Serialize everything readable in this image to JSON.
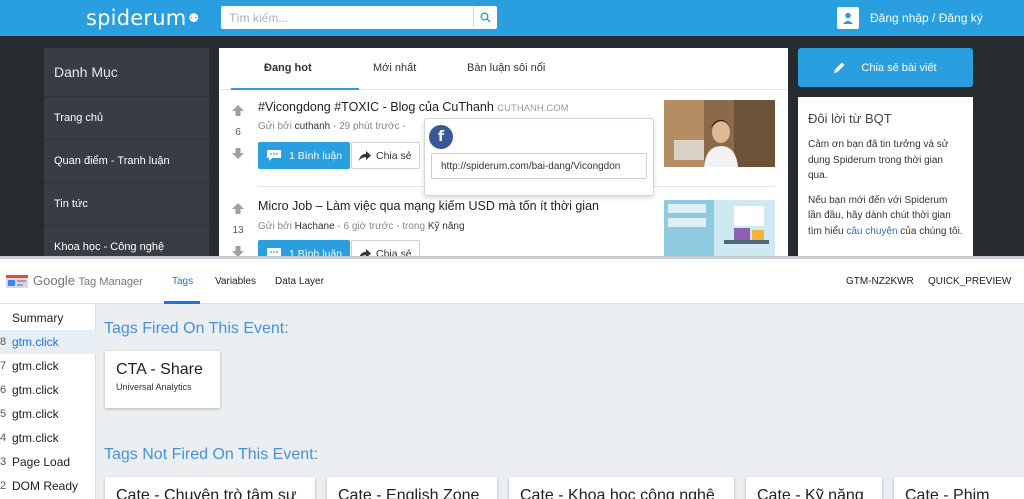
{
  "site": {
    "logo": "spiderum",
    "search_placeholder": "Tìm kiếm...",
    "login_label": "Đăng nhập / Đăng ký",
    "sidebar": {
      "title": "Danh Mục",
      "items": [
        "Trang chủ",
        "Quan điểm - Tranh luận",
        "Tin tức",
        "Khoa học - Công nghệ"
      ]
    },
    "tabs": [
      "Đang hot",
      "Mới nhất",
      "Bàn luận sôi nổi"
    ],
    "posts": [
      {
        "votes": "6",
        "title": "#Vicongdong #TOXIC - Blog của CuThanh",
        "source": "CUTHANH.COM",
        "meta_prefix": "Gửi bởi",
        "author": "cuthanh",
        "meta_time": "- 29 phút trước -",
        "meta_cat": "",
        "comments": "1 Bình luận",
        "share": "Chia sẻ"
      },
      {
        "votes": "13",
        "title": "Micro Job – Làm việc qua mạng kiếm USD mà tốn ít thời gian",
        "source": "",
        "meta_prefix": "Gửi bởi",
        "author": "Hachane",
        "meta_time": "- 6 giờ trước - trong",
        "meta_cat": "Kỹ năng",
        "comments": "1 Bình luận",
        "share": "Chia sẻ"
      }
    ],
    "share_popup_url": "http://spiderum.com/bai-dang/Vicongdon",
    "share_button": "Chia sẻ bài viết",
    "note": {
      "title": "Đôi lời từ BQT",
      "p1": "Cảm ơn bạn đã tin tưởng và sử dụng Spiderum trong thời gian qua.",
      "p2_before": "Nếu bạn mới đến với Spiderum lần đầu, hãy dành chút thời gian tìm hiểu",
      "p2_link": "câu chuyện",
      "p2_after": "của chúng tôi."
    },
    "colors": {
      "brand": "#2a9fe0",
      "dark_bg": "#262b30"
    }
  },
  "gtm": {
    "brand_google": "Google",
    "brand_product": "Tag Manager",
    "nav": [
      "Tags",
      "Variables",
      "Data Layer"
    ],
    "container_id": "GTM-NZ2KWR",
    "mode": "QUICK_PREVIEW",
    "events": [
      {
        "num": "",
        "label": "Summary"
      },
      {
        "num": "8",
        "label": "gtm.click"
      },
      {
        "num": "7",
        "label": "gtm.click"
      },
      {
        "num": "6",
        "label": "gtm.click"
      },
      {
        "num": "5",
        "label": "gtm.click"
      },
      {
        "num": "4",
        "label": "gtm.click"
      },
      {
        "num": "3",
        "label": "Page Load"
      },
      {
        "num": "2",
        "label": "DOM Ready"
      }
    ],
    "fired_heading": "Tags Fired On This Event:",
    "fired_tags": [
      {
        "name": "CTA - Share",
        "type": "Universal Analytics"
      }
    ],
    "not_fired_heading": "Tags Not Fired On This Event:",
    "not_fired_tags": [
      "Cate - Chuyện trò tâm sự",
      "Cate - English Zone",
      "Cate - Khoa học công nghệ",
      "Cate - Kỹ năng",
      "Cate - Phim"
    ],
    "colors": {
      "accent": "#1a73e8",
      "heading": "#4a90d9"
    }
  }
}
